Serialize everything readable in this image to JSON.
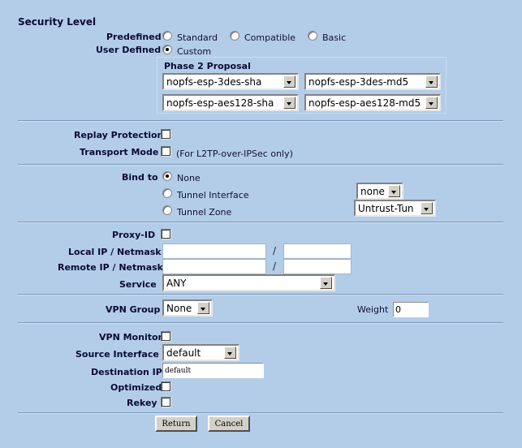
{
  "page": {
    "title": "Security Level"
  },
  "security_level": {
    "predefined_label": "Predefined",
    "user_defined_label": "User Defined",
    "predefined_options": [
      {
        "label": "Standard",
        "checked": false
      },
      {
        "label": "Compatible",
        "checked": false
      },
      {
        "label": "Basic",
        "checked": false
      }
    ],
    "custom_option": {
      "label": "Custom",
      "checked": true
    }
  },
  "phase2": {
    "title": "Phase 2 Proposal",
    "proposals": [
      "nopfs-esp-3des-sha",
      "nopfs-esp-3des-md5",
      "nopfs-esp-aes128-sha",
      "nopfs-esp-aes128-md5"
    ]
  },
  "options": {
    "replay_protection_label": "Replay Protection",
    "replay_protection_checked": false,
    "transport_mode_label": "Transport Mode",
    "transport_mode_checked": false,
    "transport_mode_note": "(For L2TP-over-IPSec only)"
  },
  "bind_to": {
    "label": "Bind to",
    "options": [
      {
        "label": "None",
        "checked": true
      },
      {
        "label": "Tunnel Interface",
        "checked": false
      },
      {
        "label": "Tunnel Zone",
        "checked": false
      }
    ],
    "tunnel_interface_value": "none",
    "tunnel_zone_value": "Untrust-Tun"
  },
  "proxy_id": {
    "label": "Proxy-ID",
    "checked": false,
    "local_label": "Local IP / Netmask",
    "local_ip": "",
    "local_netmask": "",
    "remote_label": "Remote IP / Netmask",
    "remote_ip": "",
    "remote_netmask": "",
    "separator": "/",
    "service_label": "Service",
    "service_value": "ANY"
  },
  "vpn_group": {
    "label": "VPN Group",
    "value": "None",
    "weight_label": "Weight",
    "weight_value": "0"
  },
  "vpn_monitor": {
    "label": "VPN Monitor",
    "checked": false,
    "source_interface_label": "Source Interface",
    "source_interface_value": "default",
    "destination_ip_label": "Destination IP",
    "destination_ip_value": "default",
    "optimized_label": "Optimized",
    "optimized_checked": false,
    "rekey_label": "Rekey",
    "rekey_checked": false
  },
  "footer": {
    "return_label": "Return",
    "cancel_label": "Cancel"
  }
}
